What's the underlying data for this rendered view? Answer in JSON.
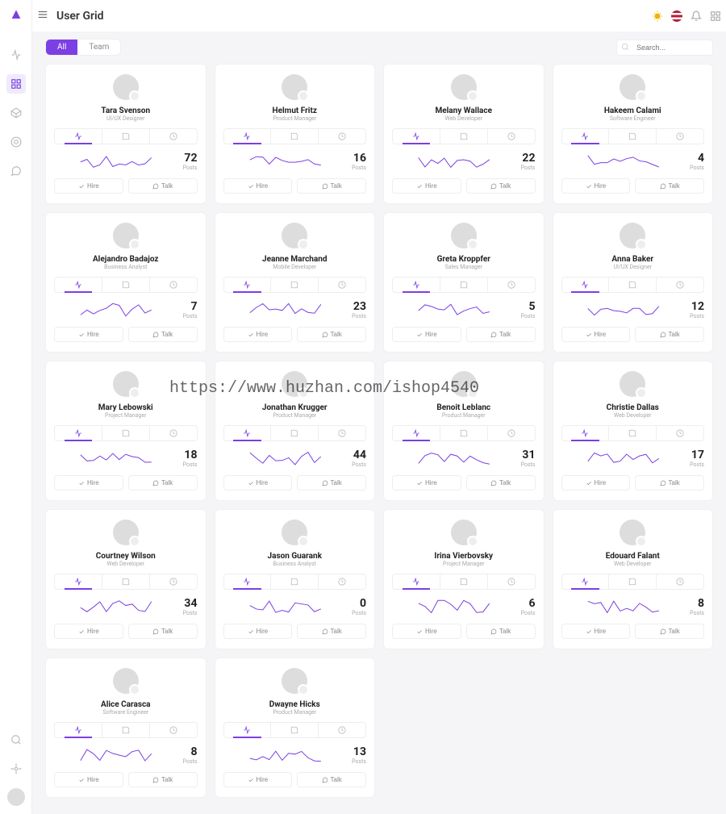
{
  "header": {
    "title": "User Grid"
  },
  "tabs": {
    "all": "All",
    "team": "Team"
  },
  "search": {
    "placeholder": "Search..."
  },
  "card_labels": {
    "posts": "Posts",
    "hire": "Hire",
    "talk": "Talk"
  },
  "users": [
    {
      "name": "Tara Svenson",
      "role": "UI/UX Designer",
      "posts": 72
    },
    {
      "name": "Helmut Fritz",
      "role": "Product Manager",
      "posts": 16
    },
    {
      "name": "Melany Wallace",
      "role": "Web Developer",
      "posts": 22
    },
    {
      "name": "Hakeem Calami",
      "role": "Software Engineer",
      "posts": 4
    },
    {
      "name": "Alejandro Badajoz",
      "role": "Business Analyst",
      "posts": 7
    },
    {
      "name": "Jeanne Marchand",
      "role": "Mobile Developer",
      "posts": 23
    },
    {
      "name": "Greta Kroppfer",
      "role": "Sales Manager",
      "posts": 5
    },
    {
      "name": "Anna Baker",
      "role": "UI/UX Designer",
      "posts": 12
    },
    {
      "name": "Mary Lebowski",
      "role": "Project Manager",
      "posts": 18
    },
    {
      "name": "Jonathan Krugger",
      "role": "Product Manager",
      "posts": 44
    },
    {
      "name": "Benoit Leblanc",
      "role": "Product Manager",
      "posts": 31
    },
    {
      "name": "Christie Dallas",
      "role": "Web Developer",
      "posts": 17
    },
    {
      "name": "Courtney Wilson",
      "role": "Web Developer",
      "posts": 34
    },
    {
      "name": "Jason Guarank",
      "role": "Business Analyst",
      "posts": 0
    },
    {
      "name": "Irina Vierbovsky",
      "role": "Project Manager",
      "posts": 6
    },
    {
      "name": "Edouard Falant",
      "role": "Web Developer",
      "posts": 8
    },
    {
      "name": "Alice Carasca",
      "role": "Software Engineer",
      "posts": 8
    },
    {
      "name": "Dwayne Hicks",
      "role": "Product Manager",
      "posts": 13
    }
  ],
  "watermark": "https://www.huzhan.com/ishop4540",
  "colors": {
    "accent": "#7b3fe4"
  }
}
